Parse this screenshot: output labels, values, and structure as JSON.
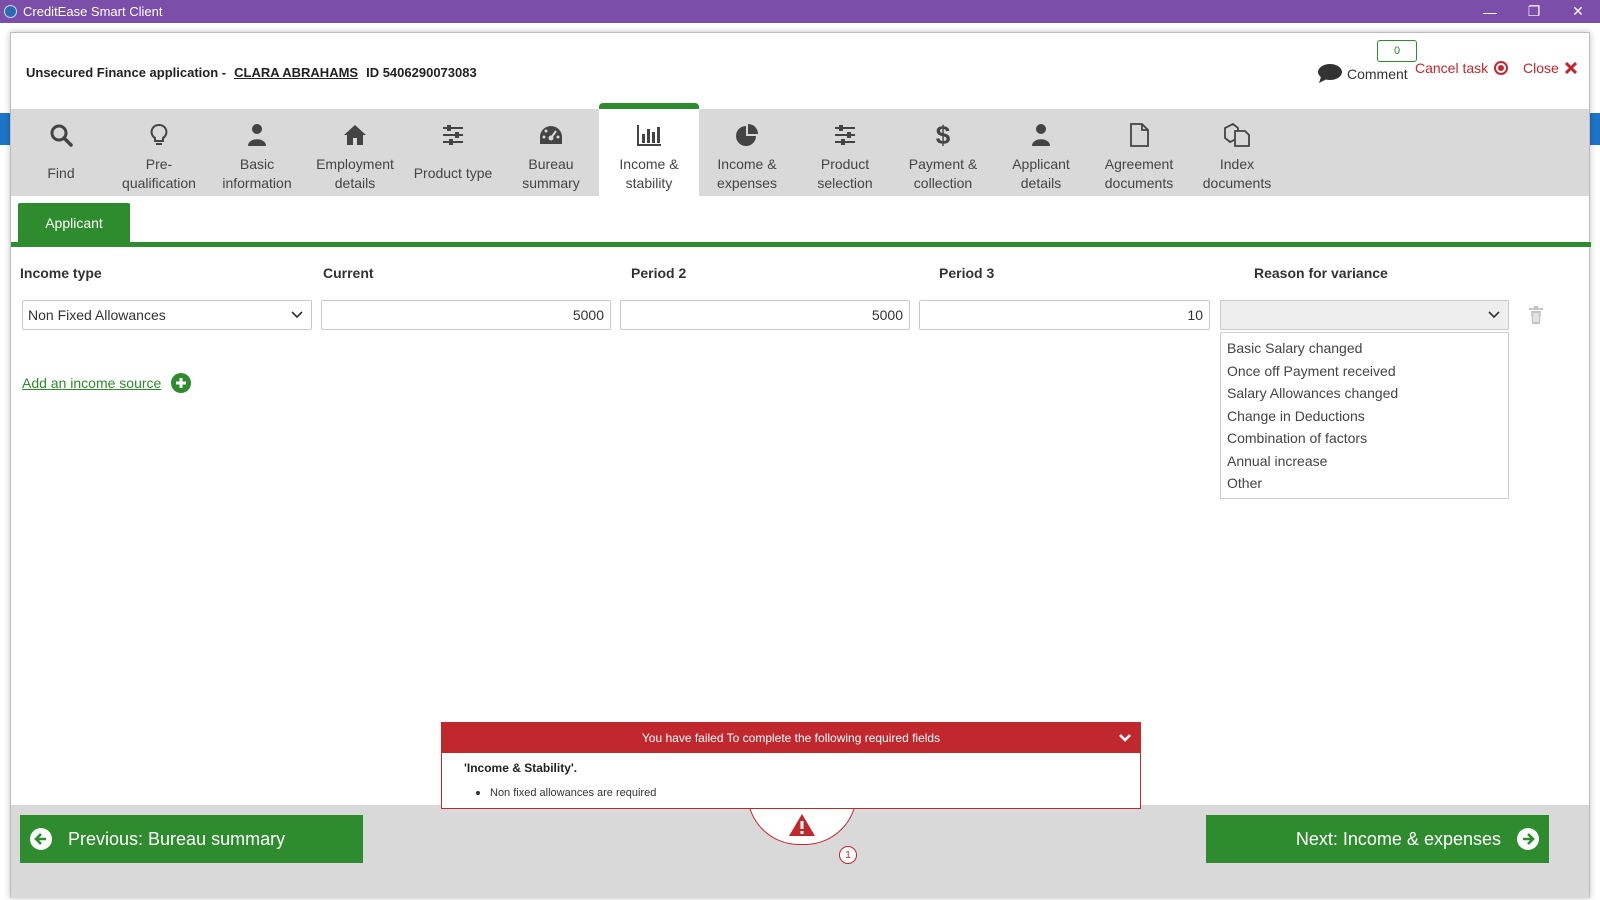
{
  "window": {
    "title": "CreditEase Smart Client"
  },
  "header": {
    "application_label": "Unsecured Finance application -",
    "applicant_name": "CLARA ABRAHAMS",
    "id_label": "ID 5406290073083",
    "comment_count": "0",
    "comment_label": "Comment",
    "cancel_task_label": "Cancel task",
    "close_label": "Close"
  },
  "nav": {
    "items": [
      {
        "line1": "Find",
        "line2": "",
        "icon": "search-icon"
      },
      {
        "line1": "Pre-",
        "line2": "qualification",
        "icon": "lightbulb-icon"
      },
      {
        "line1": "Basic",
        "line2": "information",
        "icon": "person-icon"
      },
      {
        "line1": "Employment",
        "line2": "details",
        "icon": "home-icon"
      },
      {
        "line1": "Product type",
        "line2": "",
        "icon": "sliders-icon"
      },
      {
        "line1": "Bureau",
        "line2": "summary",
        "icon": "dashboard-icon"
      },
      {
        "line1": "Income &",
        "line2": "stability",
        "icon": "bar-chart-icon"
      },
      {
        "line1": "Income &",
        "line2": "expenses",
        "icon": "pie-chart-icon"
      },
      {
        "line1": "Product",
        "line2": "selection",
        "icon": "sliders-icon"
      },
      {
        "line1": "Payment &",
        "line2": "collection",
        "icon": "dollar-icon"
      },
      {
        "line1": "Applicant",
        "line2": "details",
        "icon": "person-icon"
      },
      {
        "line1": "Agreement",
        "line2": "documents",
        "icon": "document-icon"
      },
      {
        "line1": "Index",
        "line2": "documents",
        "icon": "documents-icon"
      }
    ],
    "active_index": 6
  },
  "subtabs": {
    "applicant": "Applicant"
  },
  "table": {
    "headers": {
      "income_type": "Income type",
      "current": "Current",
      "period2": "Period 2",
      "period3": "Period 3",
      "reason": "Reason for variance"
    },
    "row": {
      "income_type": "Non Fixed Allowances",
      "current": "5000",
      "period2": "5000",
      "period3": "10",
      "reason": ""
    },
    "reason_options": [
      "Basic Salary changed",
      "Once off Payment received",
      "Salary Allowances changed",
      "Change in Deductions",
      "Combination of factors",
      "Annual increase",
      "Other"
    ]
  },
  "add_income_label": "Add an income source",
  "footer": {
    "previous_label": "Previous: Bureau summary",
    "next_label": "Next: Income & expenses",
    "warning_count": "1"
  },
  "errors": {
    "heading": "You have failed To complete the following required fields",
    "section": "'Income & Stability'.",
    "items": [
      "Non fixed allowances are required"
    ]
  },
  "colors": {
    "accent_green": "#2e8b2e",
    "error_red": "#c0282d",
    "titlebar_purple": "#7b4fa9"
  }
}
